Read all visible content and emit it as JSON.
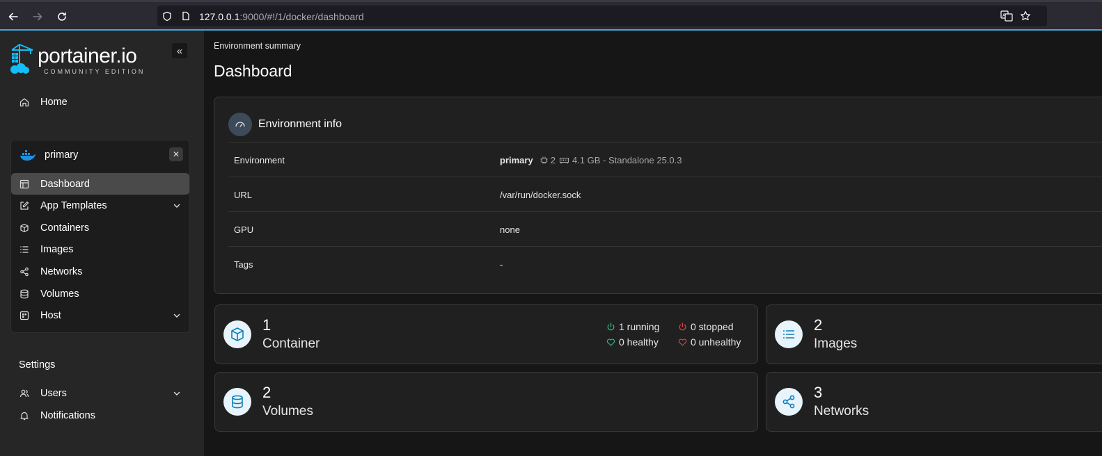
{
  "browser": {
    "url_host": "127.0.0.1",
    "url_rest": ":9000/#!/1/docker/dashboard"
  },
  "sidebar": {
    "logo_text": "portainer.io",
    "logo_sub": "COMMUNITY EDITION",
    "home_label": "Home",
    "environment": {
      "name": "primary",
      "items": [
        {
          "label": "Dashboard",
          "icon": "dashboard-icon",
          "active": true
        },
        {
          "label": "App Templates",
          "icon": "edit-icon",
          "has_chevron": true
        },
        {
          "label": "Containers",
          "icon": "box-icon"
        },
        {
          "label": "Images",
          "icon": "list-icon"
        },
        {
          "label": "Networks",
          "icon": "share-icon"
        },
        {
          "label": "Volumes",
          "icon": "database-icon"
        },
        {
          "label": "Host",
          "icon": "host-icon",
          "has_chevron": true
        }
      ]
    },
    "settings_label": "Settings",
    "users_label": "Users",
    "notifications_label": "Notifications"
  },
  "main": {
    "breadcrumb": "Environment summary",
    "title": "Dashboard",
    "env_info": {
      "title": "Environment info",
      "rows": [
        {
          "key": "Environment",
          "value_main": "primary",
          "cpu": "2",
          "mem_detail": "4.1 GB - Standalone 25.0.3"
        },
        {
          "key": "URL",
          "value": "/var/run/docker.sock"
        },
        {
          "key": "GPU",
          "value": "none"
        },
        {
          "key": "Tags",
          "value": "-"
        }
      ]
    },
    "stats": {
      "containers": {
        "count": "1",
        "label": "Container",
        "running": "1 running",
        "stopped": "0 stopped",
        "healthy": "0 healthy",
        "unhealthy": "0 unhealthy"
      },
      "images": {
        "count": "2",
        "label": "Images"
      },
      "volumes": {
        "count": "2",
        "label": "Volumes"
      },
      "networks": {
        "count": "3",
        "label": "Networks"
      }
    }
  },
  "colors": {
    "accent": "#3fa9dc",
    "running": "#2fb67a",
    "stopped": "#d84343"
  }
}
